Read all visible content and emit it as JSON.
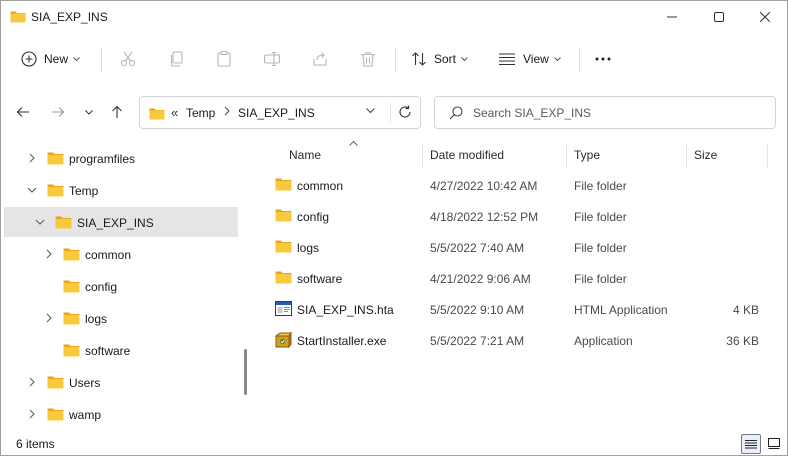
{
  "window": {
    "title": "SIA_EXP_INS"
  },
  "toolbar": {
    "new_label": "New",
    "sort_label": "Sort",
    "view_label": "View",
    "more_glyph": "•••"
  },
  "address": {
    "overflow": "«",
    "segments": [
      "Temp",
      "SIA_EXP_INS"
    ]
  },
  "search": {
    "placeholder": "Search SIA_EXP_INS"
  },
  "nav_tree": [
    {
      "label": "programfiles",
      "expanded": false,
      "has_children": true,
      "level": 0
    },
    {
      "label": "Temp",
      "expanded": true,
      "has_children": true,
      "level": 0
    },
    {
      "label": "SIA_EXP_INS",
      "expanded": true,
      "has_children": true,
      "level": 1,
      "selected": true
    },
    {
      "label": "common",
      "expanded": false,
      "has_children": true,
      "level": 2
    },
    {
      "label": "config",
      "expanded": false,
      "has_children": false,
      "level": 2
    },
    {
      "label": "logs",
      "expanded": false,
      "has_children": true,
      "level": 2
    },
    {
      "label": "software",
      "expanded": false,
      "has_children": false,
      "level": 2
    },
    {
      "label": "Users",
      "expanded": false,
      "has_children": true,
      "level": 0
    },
    {
      "label": "wamp",
      "expanded": false,
      "has_children": true,
      "level": 0
    }
  ],
  "columns": {
    "name": "Name",
    "date": "Date modified",
    "type": "Type",
    "size": "Size",
    "sort_column": "Name",
    "sort_direction": "ascending"
  },
  "files": [
    {
      "name": "common",
      "date": "4/27/2022 10:42 AM",
      "type": "File folder",
      "size": "",
      "icon": "folder-icon"
    },
    {
      "name": "config",
      "date": "4/18/2022 12:52 PM",
      "type": "File folder",
      "size": "",
      "icon": "folder-icon"
    },
    {
      "name": "logs",
      "date": "5/5/2022 7:40 AM",
      "type": "File folder",
      "size": "",
      "icon": "folder-icon"
    },
    {
      "name": "software",
      "date": "4/21/2022 9:06 AM",
      "type": "File folder",
      "size": "",
      "icon": "folder-icon"
    },
    {
      "name": "SIA_EXP_INS.hta",
      "date": "5/5/2022 9:10 AM",
      "type": "HTML Application",
      "size": "4 KB",
      "icon": "hta-file-icon"
    },
    {
      "name": "StartInstaller.exe",
      "date": "5/5/2022 7:21 AM",
      "type": "Application",
      "size": "36 KB",
      "icon": "installer-exe-icon"
    }
  ],
  "status": {
    "item_count": "6 items"
  },
  "colors": {
    "folder_yellow": "#f8c93c",
    "folder_dark": "#e3a81a",
    "selection_gray": "#e5e5e5",
    "accent_blue": "#0067c0"
  }
}
